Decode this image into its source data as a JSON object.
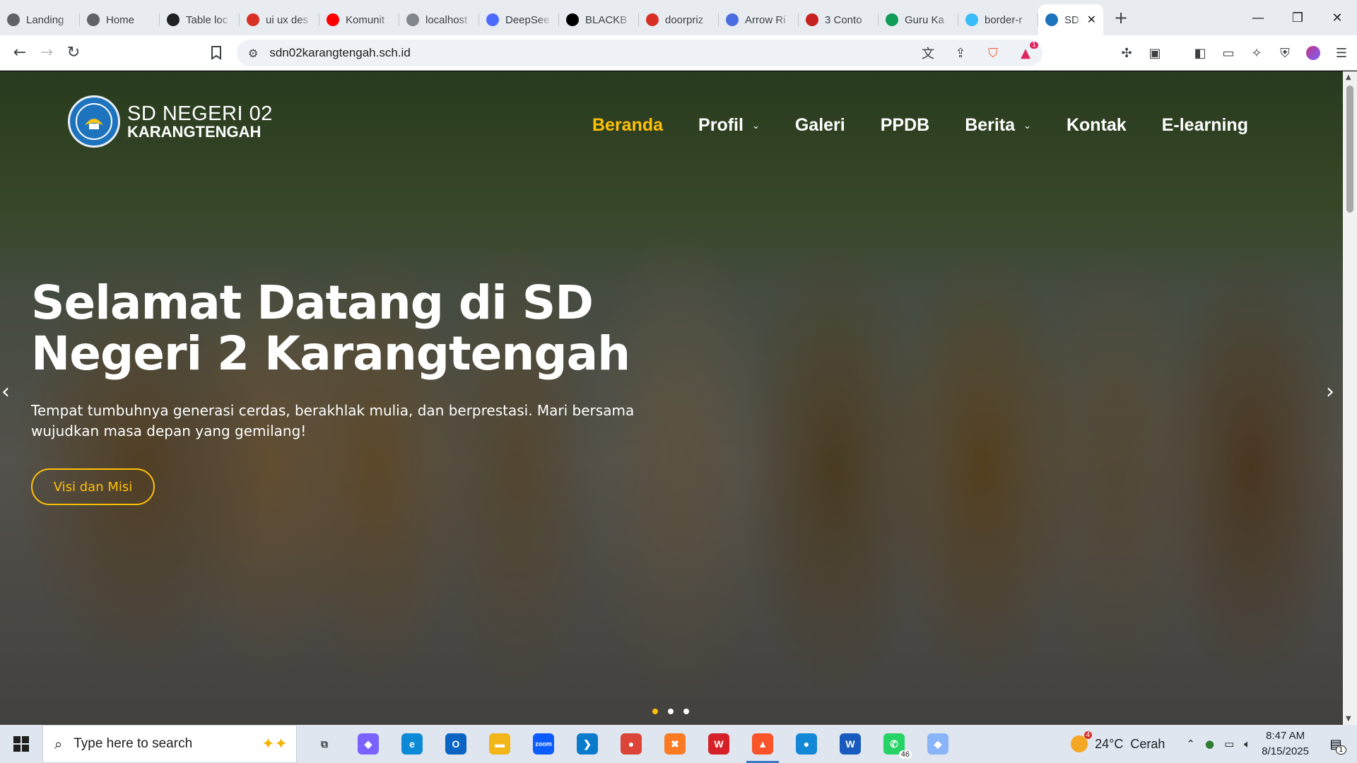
{
  "browser": {
    "tabs": [
      {
        "title": "Landing",
        "fav_color": "#5f6368",
        "fav": "globe"
      },
      {
        "title": "Home",
        "fav_color": "#5f6368",
        "fav": "globe"
      },
      {
        "title": "Table loc",
        "fav_color": "#202124",
        "fav": "openai"
      },
      {
        "title": "ui ux des",
        "fav_color": "#d93025",
        "fav": "shield"
      },
      {
        "title": "Komunit",
        "fav_color": "#ff0000",
        "fav": "youtube"
      },
      {
        "title": "localhost",
        "fav_color": "#80868b",
        "fav": "globe"
      },
      {
        "title": "DeepSee",
        "fav_color": "#4d6bfe",
        "fav": "deepseek"
      },
      {
        "title": "BLACKB",
        "fav_color": "#000000",
        "fav": "blackbox"
      },
      {
        "title": "doorpriz",
        "fav_color": "#d93025",
        "fav": "shield"
      },
      {
        "title": "Arrow Ri",
        "fav_color": "#4a6ee0",
        "fav": "square"
      },
      {
        "title": "3 Conto",
        "fav_color": "#c5221f",
        "fav": "alert"
      },
      {
        "title": "Guru Ka",
        "fav_color": "#0f9d58",
        "fav": "chart"
      },
      {
        "title": "border-r",
        "fav_color": "#38bdf8",
        "fav": "wave"
      }
    ],
    "active_tab": {
      "title": "SDN"
    },
    "address": "sdn02karangtengah.sch.id",
    "notification_badge": "1"
  },
  "site": {
    "logo": {
      "line1": "SD NEGERI 02",
      "line2": "KARANGTENGAH"
    },
    "nav": [
      {
        "label": "Beranda",
        "active": true,
        "dropdown": false
      },
      {
        "label": "Profil",
        "active": false,
        "dropdown": true
      },
      {
        "label": "Galeri",
        "active": false,
        "dropdown": false
      },
      {
        "label": "PPDB",
        "active": false,
        "dropdown": false
      },
      {
        "label": "Berita",
        "active": false,
        "dropdown": true
      },
      {
        "label": "Kontak",
        "active": false,
        "dropdown": false
      },
      {
        "label": "E-learning",
        "active": false,
        "dropdown": false
      }
    ],
    "hero": {
      "title": "Selamat Datang di SD Negeri 2 Karangtengah",
      "subtitle": "Tempat tumbuhnya generasi cerdas, berakhlak mulia, dan berprestasi. Mari bersama wujudkan masa depan yang gemilang!",
      "button": "Visi dan Misi",
      "slides": 3,
      "active_slide": 1
    },
    "accent": "#ffc107"
  },
  "taskbar": {
    "search_placeholder": "Type here to search",
    "apps": [
      {
        "name": "task-view",
        "color": "#3c4043",
        "label": "⧉"
      },
      {
        "name": "copilot",
        "color": "#7b61ff",
        "label": "◆"
      },
      {
        "name": "edge",
        "color": "#0c8ad6",
        "label": "e"
      },
      {
        "name": "outlook",
        "color": "#0a64c2",
        "label": "O"
      },
      {
        "name": "file-explorer",
        "color": "#f2b619",
        "label": "▬"
      },
      {
        "name": "zoom",
        "color": "#0b5cff",
        "label": "zoom"
      },
      {
        "name": "vscode",
        "color": "#0a7acc",
        "label": "❯"
      },
      {
        "name": "chrome",
        "color": "#db4437",
        "label": "●"
      },
      {
        "name": "xampp",
        "color": "#fb7a24",
        "label": "✖"
      },
      {
        "name": "wps-office",
        "color": "#d42026",
        "label": "W"
      },
      {
        "name": "brave",
        "color": "#fb542b",
        "label": "▲",
        "running": true
      },
      {
        "name": "onedrive",
        "color": "#1488d8",
        "label": "●"
      },
      {
        "name": "word",
        "color": "#185abd",
        "label": "W"
      },
      {
        "name": "whatsapp",
        "color": "#25d366",
        "label": "✆",
        "count": "46"
      },
      {
        "name": "gemini",
        "color": "#8ab4f8",
        "label": "◆"
      }
    ],
    "weather": {
      "temp": "24°C",
      "condition": "Cerah",
      "badge": "4"
    },
    "time": "8:47 AM",
    "date": "8/15/2025",
    "notifications": "1"
  }
}
